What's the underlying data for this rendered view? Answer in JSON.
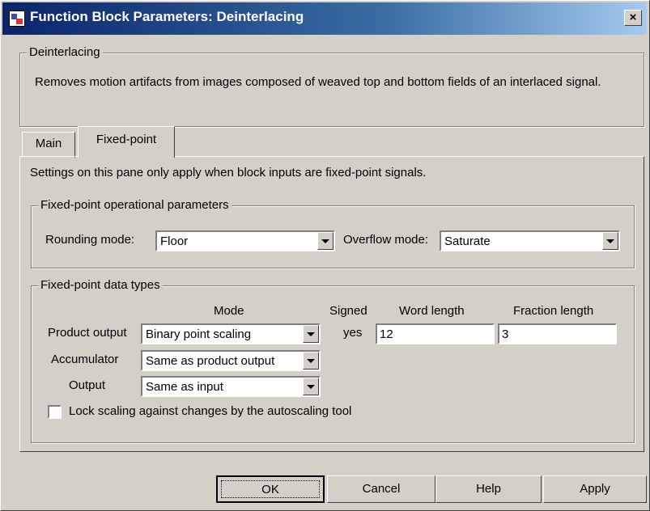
{
  "window": {
    "title": "Function Block Parameters: Deinterlacing",
    "close_glyph": "×"
  },
  "description_group": {
    "title": "Deinterlacing",
    "text": "Removes motion artifacts from images composed of weaved top and bottom fields of an interlaced signal."
  },
  "tabs": [
    {
      "label": "Main",
      "selected": false
    },
    {
      "label": "Fixed-point",
      "selected": true
    }
  ],
  "panel": {
    "note": "Settings on this pane only apply when block inputs are fixed-point signals.",
    "operational": {
      "title": "Fixed-point operational parameters",
      "rounding_label": "Rounding mode:",
      "rounding_value": "Floor",
      "overflow_label": "Overflow mode:",
      "overflow_value": "Saturate"
    },
    "datatypes": {
      "title": "Fixed-point data types",
      "headers": {
        "mode": "Mode",
        "signed": "Signed",
        "word_length": "Word length",
        "fraction_length": "Fraction length"
      },
      "rows": [
        {
          "label": "Product output",
          "mode": "Binary point scaling",
          "signed": "yes",
          "word_length": "12",
          "fraction_length": "3"
        },
        {
          "label": "Accumulator",
          "mode": "Same as product output"
        },
        {
          "label": "Output",
          "mode": "Same as input"
        }
      ],
      "lock_label": "Lock scaling against changes by the autoscaling tool",
      "lock_checked": false
    }
  },
  "buttons": {
    "ok": "OK",
    "cancel": "Cancel",
    "help": "Help",
    "apply": "Apply"
  }
}
